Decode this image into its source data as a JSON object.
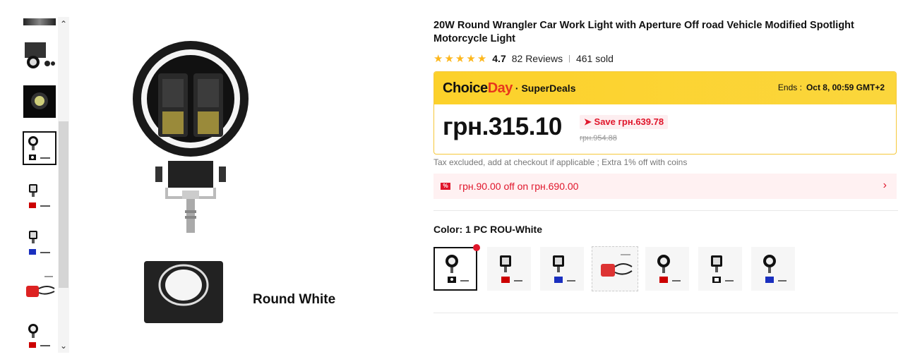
{
  "product": {
    "title": "20W Round Wrangler Car Work Light with Aperture Off road Vehicle Modified Spotlight Motorcycle Light",
    "rating_value": "4.7",
    "reviews": "82 Reviews",
    "sold": "461 sold",
    "stars": 5
  },
  "image": {
    "caption": "Round White"
  },
  "deal": {
    "choice": "Choice",
    "day": "Day",
    "superdeals": "· SuperDeals",
    "ends_label": "Ends :",
    "ends_value": "Oct 8, 00:59 GMT+2",
    "price": "грн.315.10",
    "save": "Save грн.639.78",
    "old_price": "грн.954.88"
  },
  "tax_note": "Tax excluded, add at checkout if applicable ; Extra 1% off with coins",
  "coupon": {
    "icon": "%",
    "text": "грн.90.00 off on грн.690.00"
  },
  "color": {
    "label": "Color: 1 PC ROU-White",
    "options": [
      "Round White",
      "Square Red",
      "Square Blue",
      "Switch Wiring",
      "Round Red",
      "Square White",
      "Round Blue"
    ]
  },
  "colors": {
    "accent": "#e0162b",
    "deal_bg": "#fcd12a",
    "star": "#fdb71c"
  }
}
